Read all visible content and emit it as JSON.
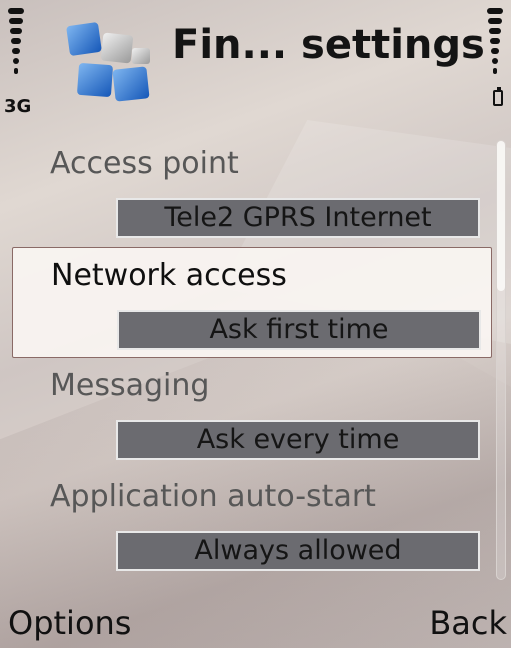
{
  "status": {
    "network": "3G",
    "signal_level": 1.0,
    "battery_level": 1.0
  },
  "header": {
    "title": "Fin... settings",
    "icon": "settings-tiles-icon"
  },
  "settings": [
    {
      "label": "Access point",
      "value": "Tele2 GPRS Internet",
      "selected": false
    },
    {
      "label": "Network access",
      "value": "Ask first time",
      "selected": true
    },
    {
      "label": "Messaging",
      "value": "Ask every time",
      "selected": false
    },
    {
      "label": "Application auto-start",
      "value": "Always allowed",
      "selected": false
    }
  ],
  "softkeys": {
    "left": "Options",
    "right": "Back"
  },
  "colors": {
    "value_box": "#6b6b70",
    "selection_bg": "#faf5f2",
    "label_text": "#575757",
    "icon_blue": "#1f6fd0"
  }
}
